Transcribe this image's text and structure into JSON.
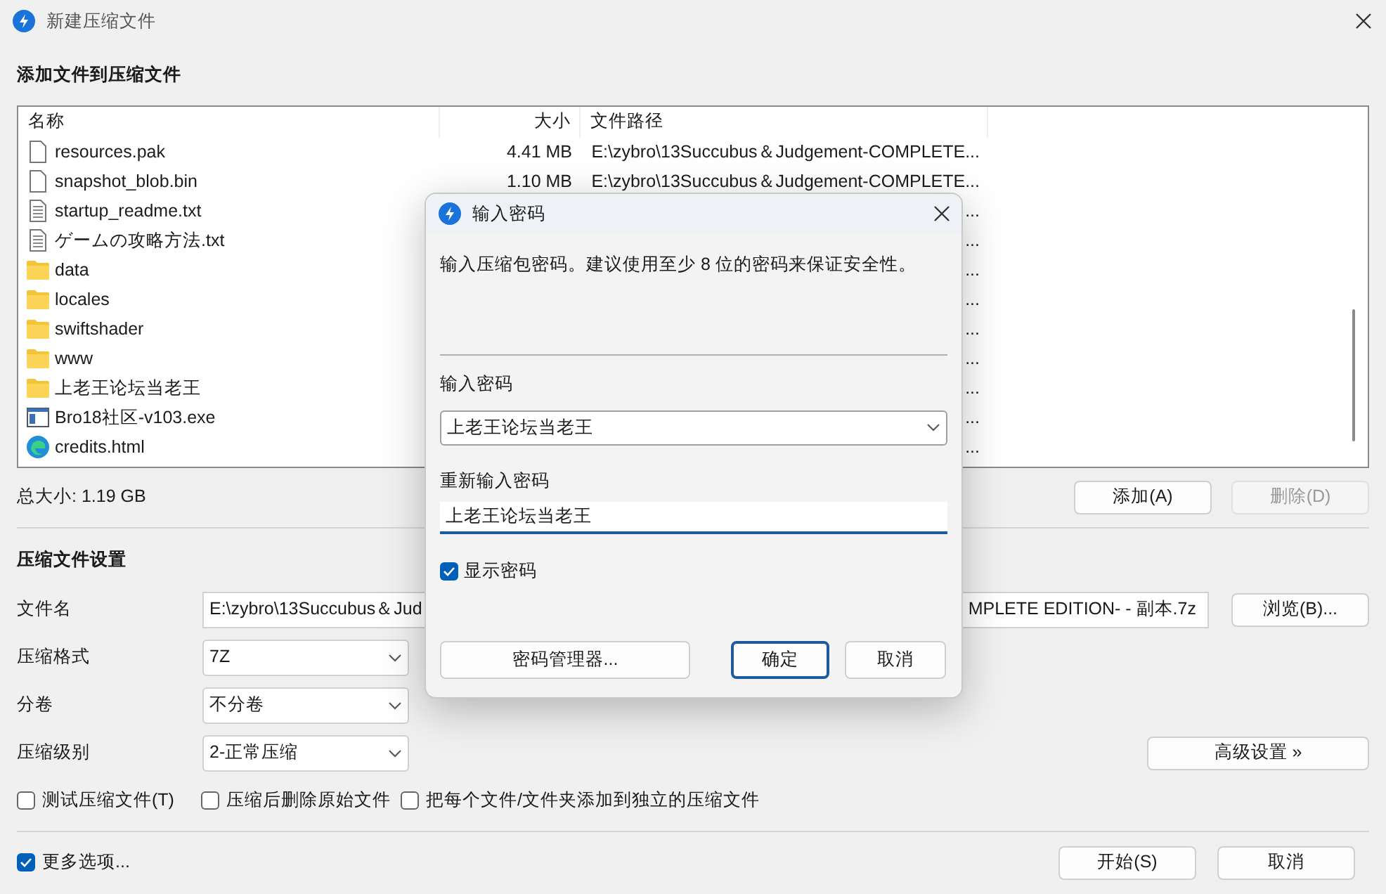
{
  "window": {
    "title": "新建压缩文件"
  },
  "files_section": {
    "title": "添加文件到压缩文件",
    "columns": [
      "名称",
      "大小",
      "文件路径"
    ],
    "rows": [
      {
        "kind": "file",
        "name": "resources.pak",
        "size": "4.41 MB",
        "path": "E:\\zybro\\13Succubus＆Judgement-COMPLETE..."
      },
      {
        "kind": "file",
        "name": "snapshot_blob.bin",
        "size": "1.10 MB",
        "path": "E:\\zybro\\13Succubus＆Judgement-COMPLETE..."
      },
      {
        "kind": "text",
        "name": "startup_readme.txt",
        "path": "..."
      },
      {
        "kind": "text",
        "name": "ゲームの攻略方法.txt",
        "path": "..."
      },
      {
        "kind": "folder",
        "name": "data",
        "path": "..."
      },
      {
        "kind": "folder",
        "name": "locales",
        "path": "..."
      },
      {
        "kind": "folder",
        "name": "swiftshader",
        "path": "..."
      },
      {
        "kind": "folder",
        "name": "www",
        "path": "..."
      },
      {
        "kind": "folder",
        "name": "上老王论坛当老王",
        "path": "..."
      },
      {
        "kind": "exe",
        "name": "Bro18社区-v103.exe",
        "path": "..."
      },
      {
        "kind": "web",
        "name": "credits.html",
        "path": "..."
      }
    ],
    "total": "总大小: 1.19 GB",
    "buttons": [
      {
        "label": "添加(A)",
        "disabled": false
      },
      {
        "label": "删除(D)",
        "disabled": true
      }
    ]
  },
  "settings": {
    "title": "压缩文件设置",
    "filename": {
      "label": "文件名",
      "value_start": "E:\\zybro\\13Succubus＆Jud",
      "value_end": "MPLETE EDITION- - 副本.7z",
      "button": "浏览(B)..."
    },
    "selects": [
      {
        "label": "压缩格式",
        "value": "7Z"
      },
      {
        "label": "分卷",
        "value": "不分卷"
      },
      {
        "label": "压缩级别",
        "value": "2-正常压缩"
      }
    ],
    "advanced_button": "高级设置 »",
    "options": [
      {
        "label": "测试压缩文件(T)",
        "checked": false
      },
      {
        "label": "压缩后删除原始文件",
        "checked": false
      },
      {
        "label": "把每个文件/文件夹添加到独立的压缩文件",
        "checked": false
      }
    ]
  },
  "footer": {
    "more_options": {
      "label": "更多选项...",
      "checked": true
    },
    "buttons": [
      {
        "label": "开始(S)"
      },
      {
        "label": "取消"
      }
    ]
  },
  "dialog": {
    "title": "输入密码",
    "message": "输入压缩包密码。建议使用至少 8 位的密码来保证安全性。",
    "password_label": "输入密码",
    "password": "上老王论坛当老王",
    "confirm_label": "重新输入密码",
    "confirm": "上老王论坛当老王",
    "show_password": {
      "label": "显示密码",
      "checked": true
    },
    "buttons": [
      {
        "label": "密码管理器...",
        "default": false
      },
      {
        "label": "确定",
        "default": true
      },
      {
        "label": "取消",
        "default": false
      }
    ]
  }
}
